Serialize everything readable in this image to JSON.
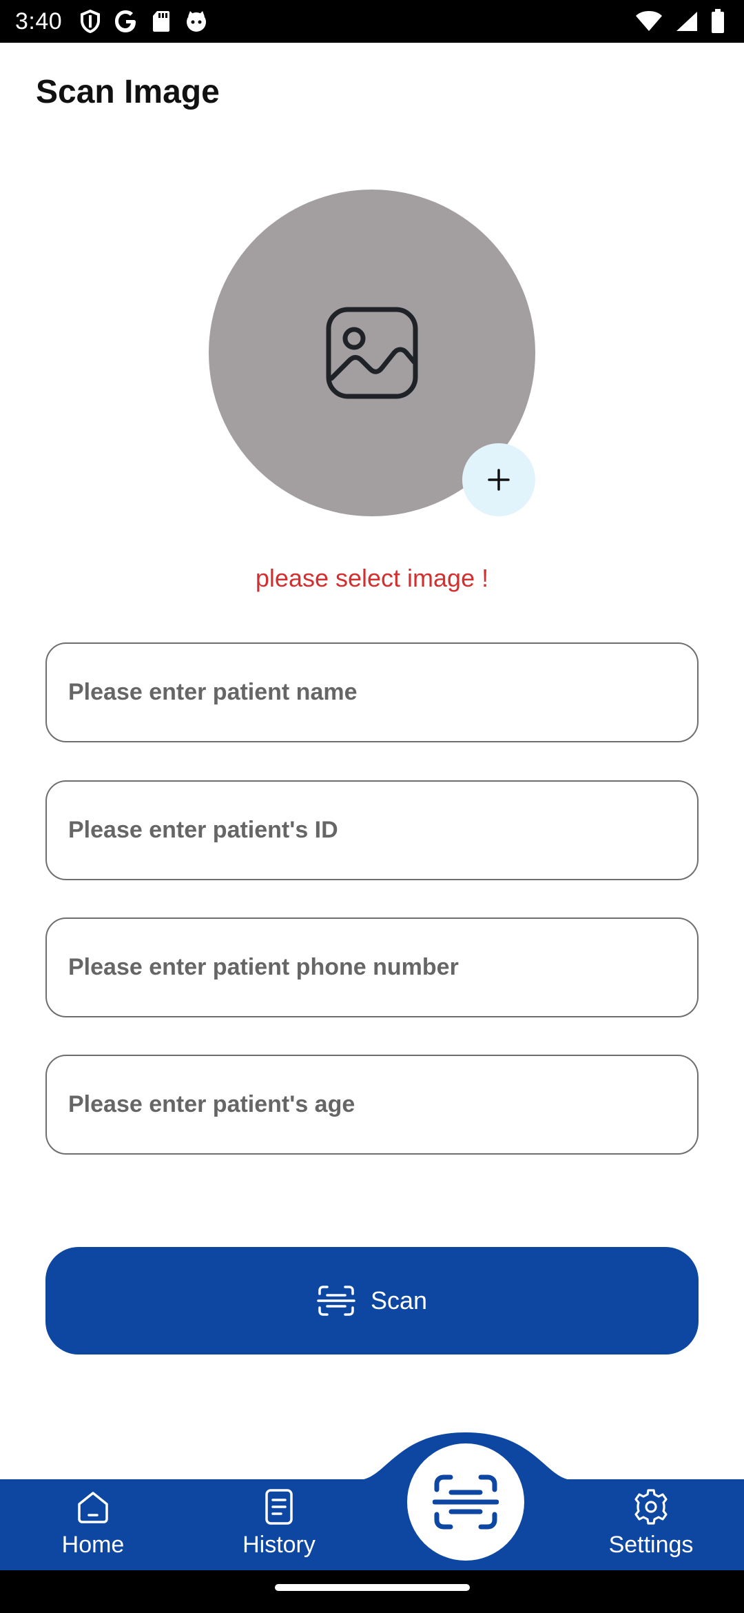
{
  "status_bar": {
    "time": "3:40"
  },
  "page": {
    "title": "Scan Image"
  },
  "image_picker": {
    "error": "please select image !"
  },
  "form": {
    "name_placeholder": "Please enter patient name",
    "id_placeholder": "Please enter patient's ID",
    "phone_placeholder": "Please enter patient phone number",
    "age_placeholder": "Please enter patient's age"
  },
  "scan_button": {
    "label": "Scan"
  },
  "bottom_nav": {
    "items": [
      {
        "label": "Home",
        "icon": "home-icon"
      },
      {
        "label": "History",
        "icon": "document-icon"
      },
      {
        "label": "",
        "icon": "scan-icon"
      },
      {
        "label": "Settings",
        "icon": "gear-icon"
      }
    ]
  },
  "colors": {
    "primary": "#0d47a1",
    "error": "#d32f2f",
    "avatar_bg": "#a39fa0",
    "add_button_bg": "#e1f3fb"
  }
}
